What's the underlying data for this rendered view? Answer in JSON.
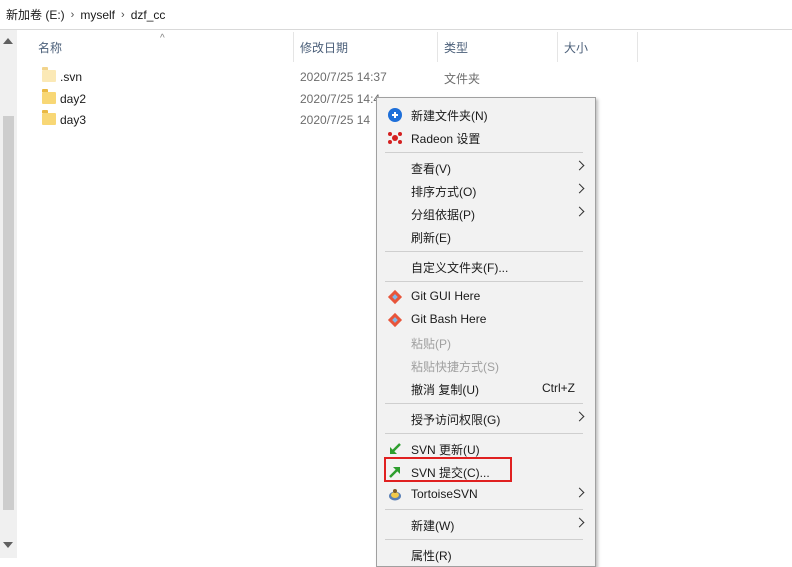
{
  "breadcrumb": {
    "items": [
      "新加卷 (E:)",
      "myself",
      "dzf_cc"
    ],
    "separator": "›"
  },
  "columns": {
    "name": "名称",
    "modified": "修改日期",
    "type": "类型",
    "size": "大小"
  },
  "files": [
    {
      "name": ".svn",
      "date": "2020/7/25 14:37",
      "type": "文件夹"
    },
    {
      "name": "day2",
      "date": "2020/7/25 14:4",
      "type": ""
    },
    {
      "name": "day3",
      "date": "2020/7/25 14",
      "type": ""
    }
  ],
  "context_menu": {
    "items": {
      "new_folder": "新建文件夹(N)",
      "radeon": "Radeon 设置",
      "view": "查看(V)",
      "sort": "排序方式(O)",
      "group": "分组依据(P)",
      "refresh": "刷新(E)",
      "customize": "自定义文件夹(F)...",
      "git_gui": "Git GUI Here",
      "git_bash": "Git Bash Here",
      "paste": "粘贴(P)",
      "paste_shortcut": "粘贴快捷方式(S)",
      "undo": "撤消 复制(U)",
      "undo_shortcut": "Ctrl+Z",
      "grant_access": "授予访问权限(G)",
      "svn_update": "SVN 更新(U)",
      "svn_commit": "SVN 提交(C)...",
      "tortoise": "TortoiseSVN",
      "new": "新建(W)",
      "properties": "属性(R)"
    }
  },
  "colors": {
    "highlight": "#e02020",
    "header_text": "#4c607a",
    "folder": "#f8d775"
  }
}
